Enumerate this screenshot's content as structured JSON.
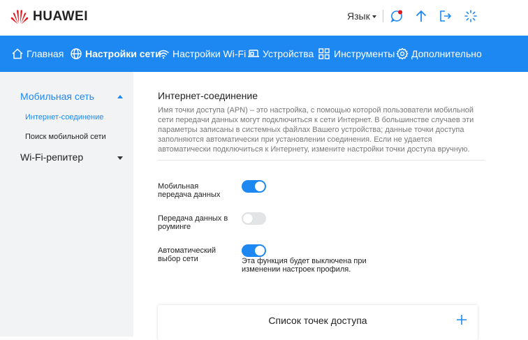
{
  "header": {
    "brand": "HUAWEI",
    "language_label": "Язык"
  },
  "nav": {
    "items": [
      {
        "label": "Главная",
        "icon": "home-icon"
      },
      {
        "label": "Настройки сети",
        "icon": "globe-icon",
        "active": true
      },
      {
        "label": "Настройки Wi-Fi",
        "icon": "wifi-icon"
      },
      {
        "label": "Устройства",
        "icon": "devices-icon"
      },
      {
        "label": "Инструменты",
        "icon": "grid-icon"
      },
      {
        "label": "Дополнительно",
        "icon": "gear-icon"
      }
    ]
  },
  "sidebar": {
    "groups": [
      {
        "label": "Мобильная сеть",
        "expanded": true,
        "items": [
          {
            "label": "Интернет-соединение",
            "active": true
          },
          {
            "label": "Поиск мобильной сети"
          }
        ]
      },
      {
        "label": "Wi-Fi-репитер",
        "expanded": false
      }
    ]
  },
  "main": {
    "title": "Интернет-соединение",
    "description": "Имя точки доступа (APN) – это настройка, с помощью которой пользователи мобильной сети передачи данных могут подключиться к сети Интернет. В большинстве случаев эти параметры записаны в системных файлах Вашего устройства; данные точки доступа заполняются автоматически при установлении соединения. Если не удается автоматически подключиться к Интернету, измените настройки точки доступа вручную.",
    "toggles": [
      {
        "label": "Мобильная передача данных",
        "on": true
      },
      {
        "label": "Передача данных в роуминге",
        "on": false
      },
      {
        "label": "Автоматический выбор сети",
        "on": true,
        "note": "Эта функция будет выключена при изменении настроек профиля."
      }
    ],
    "ap_list_title": "Список точек доступа"
  },
  "colors": {
    "accent": "#1e88f2",
    "brand_red": "#e3161c",
    "sidebar_bg": "#f2f3f5"
  }
}
